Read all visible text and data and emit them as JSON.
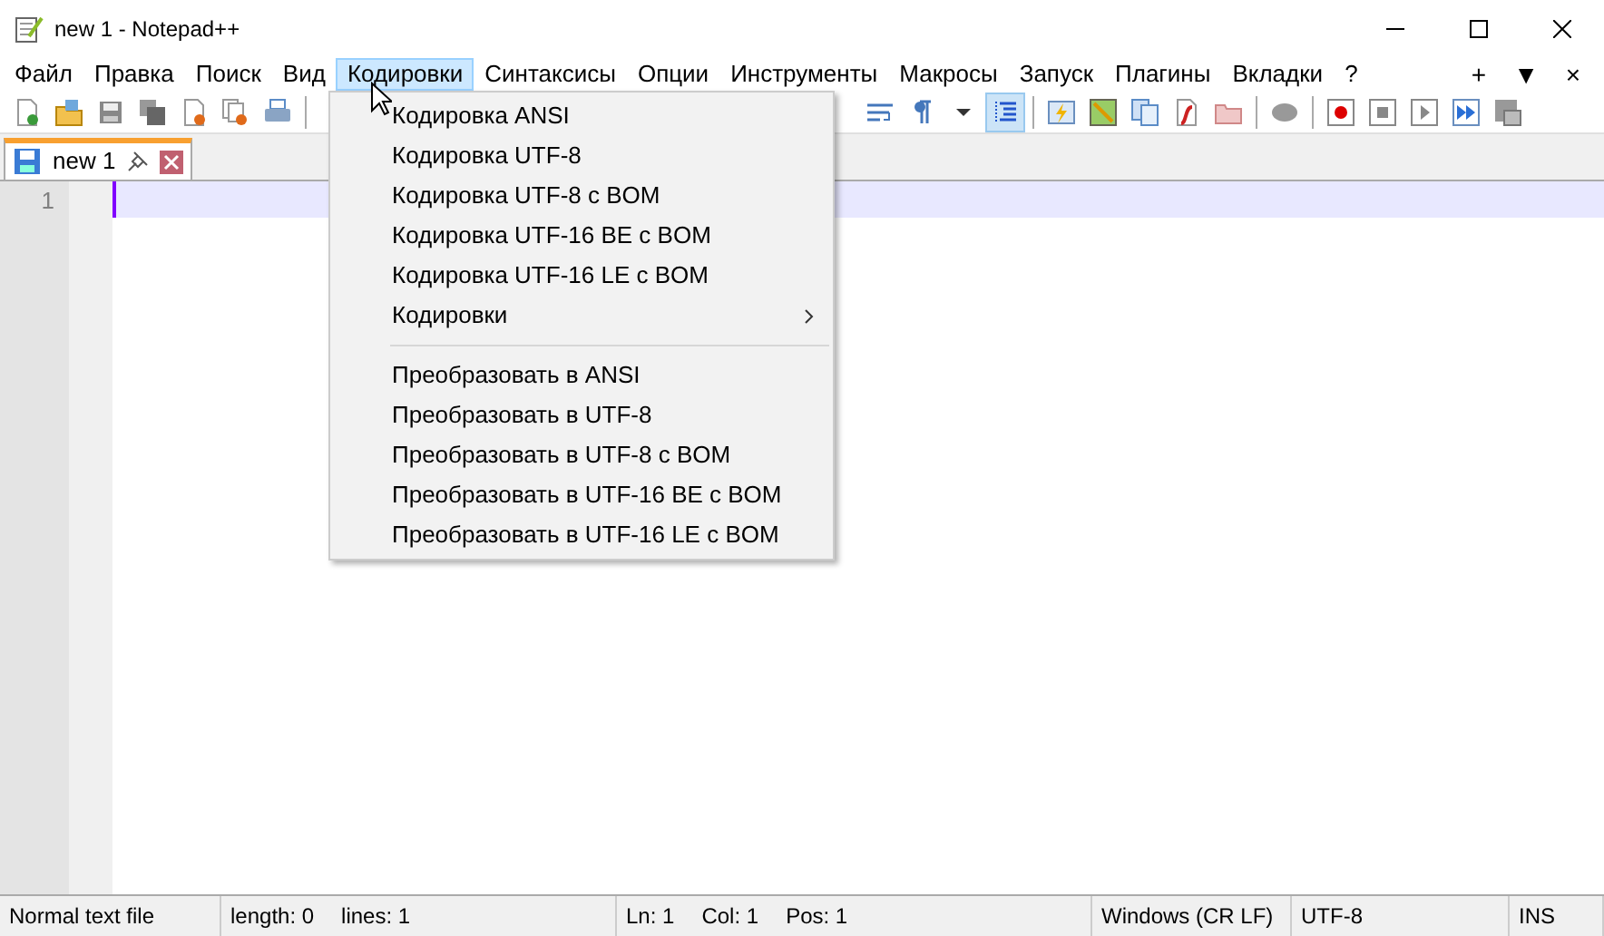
{
  "window": {
    "title": "new 1 - Notepad++"
  },
  "menu": [
    {
      "label": "Файл",
      "selected": false
    },
    {
      "label": "Правка",
      "selected": false
    },
    {
      "label": "Поиск",
      "selected": false
    },
    {
      "label": "Вид",
      "selected": false
    },
    {
      "label": "Кодировки",
      "selected": true
    },
    {
      "label": "Синтаксисы",
      "selected": false
    },
    {
      "label": "Опции",
      "selected": false
    },
    {
      "label": "Инструменты",
      "selected": false
    },
    {
      "label": "Макросы",
      "selected": false
    },
    {
      "label": "Запуск",
      "selected": false
    },
    {
      "label": "Плагины",
      "selected": false
    },
    {
      "label": "Вкладки",
      "selected": false
    },
    {
      "label": "?",
      "selected": false
    }
  ],
  "menu_right": [
    "+",
    "▼",
    "×"
  ],
  "toolbar_right": [
    {
      "selected": false
    },
    {
      "selected": false
    },
    {
      "selected": false
    },
    {
      "selected": true
    },
    {
      "selected": false
    },
    {
      "selected": false
    },
    {
      "selected": false
    },
    {
      "selected": false
    },
    {
      "selected": false
    },
    {
      "selected": false
    },
    {
      "selected": false
    },
    {
      "selected": false
    },
    {
      "selected": false
    },
    {
      "selected": false
    },
    {
      "selected": false
    }
  ],
  "tabs": [
    {
      "label": "new 1",
      "selected": true
    }
  ],
  "editor": {
    "line_numbers": [
      "1"
    ]
  },
  "dropdown": [
    {
      "kind": "item",
      "label": "Кодировка ANSI"
    },
    {
      "kind": "item",
      "label": "Кодировка UTF-8"
    },
    {
      "kind": "item",
      "label": "Кодировка UTF-8 с BOM"
    },
    {
      "kind": "item",
      "label": "Кодировка UTF-16 BE с BOM"
    },
    {
      "kind": "item",
      "label": "Кодировка UTF-16 LE с BOM"
    },
    {
      "kind": "submenu",
      "label": "Кодировки"
    },
    {
      "kind": "separator"
    },
    {
      "kind": "item",
      "label": "Преобразовать в ANSI"
    },
    {
      "kind": "item",
      "label": "Преобразовать в UTF-8"
    },
    {
      "kind": "item",
      "label": "Преобразовать в UTF-8 с BOM"
    },
    {
      "kind": "item",
      "label": "Преобразовать в UTF-16 BE с BOM"
    },
    {
      "kind": "item",
      "label": "Преобразовать в UTF-16 LE с BOM"
    }
  ],
  "status_bar": [
    [
      "Normal text file"
    ],
    [
      "length: 0",
      "lines: 1"
    ],
    [
      "Ln: 1",
      "Col: 1",
      "Pos: 1"
    ],
    [
      "Windows (CR LF)"
    ],
    [
      "UTF-8"
    ],
    [
      "INS"
    ]
  ]
}
